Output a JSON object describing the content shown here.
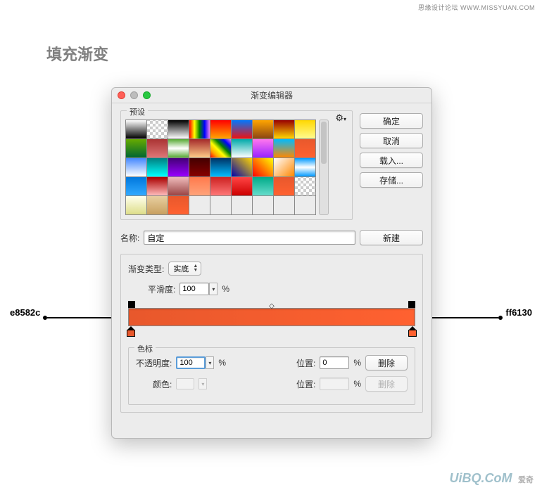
{
  "watermark_top": "思缘设计论坛  WWW.MISSYUAN.COM",
  "heading": "填充渐变",
  "dialog": {
    "title": "渐变编辑器",
    "presets_label": "预设",
    "gear_icon": "⚙",
    "buttons": {
      "ok": "确定",
      "cancel": "取消",
      "load": "载入...",
      "save": "存储..."
    },
    "name_label": "名称:",
    "name_value": "自定",
    "new_button": "新建",
    "gradient_type_label": "渐变类型:",
    "gradient_type_value": "实底",
    "smoothness_label": "平滑度:",
    "smoothness_value": "100",
    "smoothness_unit": "%",
    "stops": {
      "legend": "色标",
      "opacity_label": "不透明度:",
      "opacity_value": "100",
      "opacity_unit": "%",
      "position_label": "位置:",
      "position_value_1": "0",
      "position_value_2": "",
      "position_unit": "%",
      "delete": "删除",
      "color_label": "颜色:"
    }
  },
  "callouts": {
    "left": "e8582c",
    "right": "ff6130"
  },
  "colors": {
    "left_stop": "#e8582c",
    "right_stop": "#ff6130"
  },
  "preset_swatches": [
    "linear-gradient(#fff,#000)",
    "repeating-conic-gradient(#ccc 0 25%,#fff 0 50%) 0/8px 8px",
    "linear-gradient(#000,#fff)",
    "linear-gradient(to right,red,yellow,green,blue,violet)",
    "linear-gradient(red,orange)",
    "linear-gradient(#07f,#e11)",
    "linear-gradient(orange,#8b4513)",
    "linear-gradient(#900,gold)",
    "linear-gradient(gold,#fffb8f)",
    "linear-gradient(#6a0,#063)",
    "linear-gradient(#a33,#d77)",
    "linear-gradient(#5a3,#fff,#5a3)",
    "linear-gradient(#a52a2a,#ffcc88)",
    "linear-gradient(45deg,red,orange,yellow,green,blue,violet)",
    "linear-gradient(#0aa,#fff)",
    "linear-gradient(#f7e,#92f)",
    "linear-gradient(#0bf,#f80)",
    "linear-gradient(#e8582c,#ff6130)",
    "linear-gradient(#48f,#fff)",
    "linear-gradient(teal,#0ff)",
    "linear-gradient(#407,#90f)",
    "linear-gradient(#400,#800)",
    "linear-gradient(#036,#0bf)",
    "linear-gradient(45deg,#00a,gold)",
    "linear-gradient(45deg,red,yellow)",
    "linear-gradient(135deg,#fff,#f80)",
    "linear-gradient(#09f,#fff,#09f)",
    "linear-gradient(#07d,#3af)",
    "linear-gradient(#a00,#fbb)",
    "linear-gradient(#ebb,#944)",
    "linear-gradient(#ff7a4d,#ffa37a)",
    "linear-gradient(#c22,#f77)",
    "linear-gradient(#f44,#c00)",
    "linear-gradient(#0a8,#6dc)",
    "linear-gradient(#e8582c,#ff6130)",
    "repeating-conic-gradient(#ccc 0 25%,#fff 0 50%) 0/8px 8px",
    "linear-gradient(#ffe,#dd8)",
    "linear-gradient(#e8cfa0,#c8a060)",
    "linear-gradient(#e8582c,#ff6130)",
    "linear-gradient(#fff,#fff)",
    "linear-gradient(#fff,#fff)",
    "linear-gradient(#fff,#fff)",
    "linear-gradient(#fff,#fff)",
    "linear-gradient(#fff,#fff)",
    "linear-gradient(#fff,#fff)"
  ],
  "bottom_watermark": {
    "main": "UiBQ.CoM",
    "sub": "爱奇"
  }
}
